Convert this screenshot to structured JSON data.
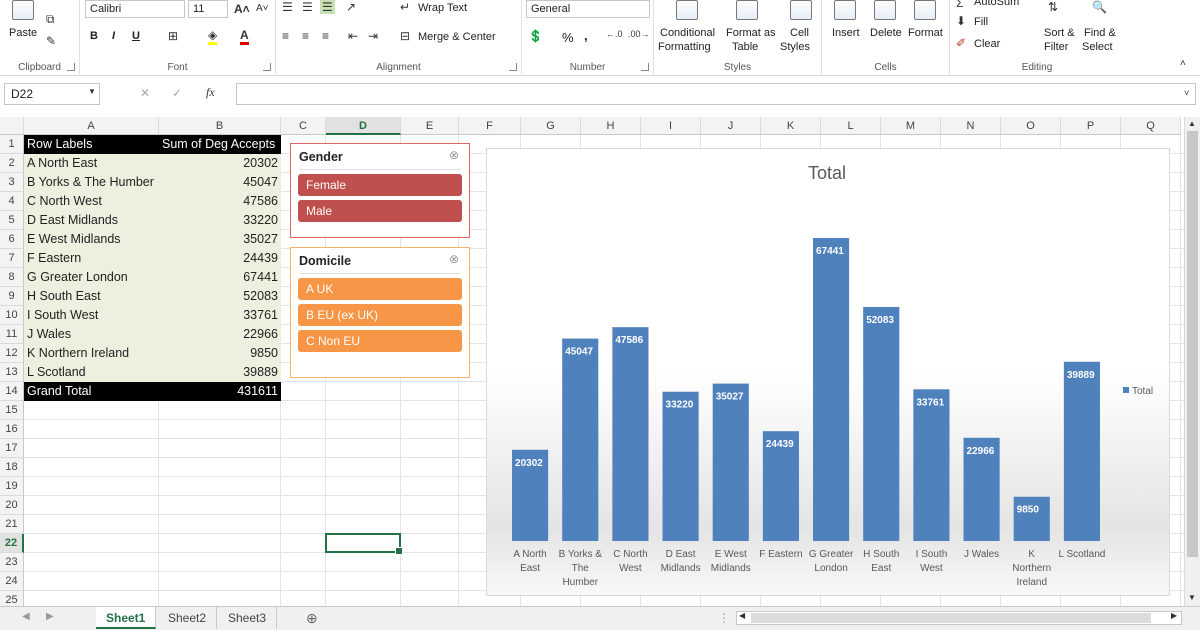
{
  "ribbon": {
    "clipboard": {
      "paste": "Paste",
      "title": "Clipboard"
    },
    "font": {
      "name": "Calibri",
      "size": "11",
      "bold": "B",
      "italic": "I",
      "underline": "U",
      "title": "Font"
    },
    "alignment": {
      "wrap": "Wrap Text",
      "merge": "Merge & Center",
      "title": "Alignment"
    },
    "number": {
      "format": "General",
      "percent": "%",
      "comma": ",",
      "title": "Number"
    },
    "styles": {
      "conditional_1": "Conditional",
      "conditional_2": "Formatting",
      "format_table_1": "Format as",
      "format_table_2": "Table",
      "cell_styles_1": "Cell",
      "cell_styles_2": "Styles",
      "title": "Styles"
    },
    "cells": {
      "insert": "Insert",
      "delete": "Delete",
      "format": "Format",
      "title": "Cells"
    },
    "editing": {
      "autosum": "AutoSum",
      "fill": "Fill",
      "clear": "Clear",
      "sort_1": "Sort &",
      "sort_2": "Filter",
      "find_1": "Find &",
      "find_2": "Select",
      "title": "Editing"
    }
  },
  "formula_bar": {
    "name_box": "D22",
    "fx": "fx",
    "formula": ""
  },
  "columns": [
    "A",
    "B",
    "C",
    "D",
    "E",
    "F",
    "G",
    "H",
    "I",
    "J",
    "K",
    "L",
    "M",
    "N",
    "O",
    "P",
    "Q"
  ],
  "rows": [
    "1",
    "2",
    "3",
    "4",
    "5",
    "6",
    "7",
    "8",
    "9",
    "10",
    "11",
    "12",
    "13",
    "14",
    "15",
    "16",
    "17",
    "18",
    "19",
    "20",
    "21",
    "22",
    "23",
    "24",
    "25"
  ],
  "pivot": {
    "header_labels": "Row Labels",
    "header_values": "Sum of Deg Accepts",
    "rows": [
      {
        "label": "A North East",
        "value": "20302"
      },
      {
        "label": "B Yorks & The Humber",
        "value": "45047"
      },
      {
        "label": "C North West",
        "value": "47586"
      },
      {
        "label": "D East Midlands",
        "value": "33220"
      },
      {
        "label": "E West Midlands",
        "value": "35027"
      },
      {
        "label": "F Eastern",
        "value": "24439"
      },
      {
        "label": "G Greater London",
        "value": "67441"
      },
      {
        "label": "H South East",
        "value": "52083"
      },
      {
        "label": "I South West",
        "value": "33761"
      },
      {
        "label": "J Wales",
        "value": "22966"
      },
      {
        "label": "K Northern Ireland",
        "value": "9850"
      },
      {
        "label": "L Scotland",
        "value": "39889"
      }
    ],
    "total_label": "Grand Total",
    "total_value": "431611"
  },
  "slicer_gender": {
    "title": "Gender",
    "items": [
      "Female",
      "Male"
    ],
    "color": "#c0504d",
    "border": "#e06666"
  },
  "slicer_domicile": {
    "title": "Domicile",
    "items": [
      "A UK",
      "B EU (ex UK)",
      "C Non EU"
    ],
    "color": "#f79646",
    "border": "#f6b26b"
  },
  "chart_data": {
    "type": "bar",
    "title": "Total",
    "categories": [
      "A North East",
      "B Yorks & The Humber",
      "C North West",
      "D East Midlands",
      "E West Midlands",
      "F Eastern",
      "G Greater London",
      "H South East",
      "I South West",
      "J Wales",
      "K Northern Ireland",
      "L Scotland"
    ],
    "category_lines": [
      [
        "A North",
        "East"
      ],
      [
        "B Yorks &",
        "The",
        "Humber"
      ],
      [
        "C North",
        "West"
      ],
      [
        "D East",
        "Midlands"
      ],
      [
        "E West",
        "Midlands"
      ],
      [
        "F Eastern"
      ],
      [
        "G Greater",
        "London"
      ],
      [
        "H South",
        "East"
      ],
      [
        "I South",
        "West"
      ],
      [
        "J Wales"
      ],
      [
        "K",
        "Northern",
        "Ireland"
      ],
      [
        "L Scotland"
      ]
    ],
    "series": [
      {
        "name": "Total",
        "values": [
          20302,
          45047,
          47586,
          33220,
          35027,
          24439,
          67441,
          52083,
          33761,
          22966,
          9850,
          39889
        ]
      }
    ],
    "ylim": [
      0,
      75000
    ],
    "grid": false,
    "legend": "right",
    "bar_color": "#4f81bd",
    "xlabel": "",
    "ylabel": ""
  },
  "sheets": [
    "Sheet1",
    "Sheet2",
    "Sheet3"
  ],
  "active_sheet": "Sheet1"
}
